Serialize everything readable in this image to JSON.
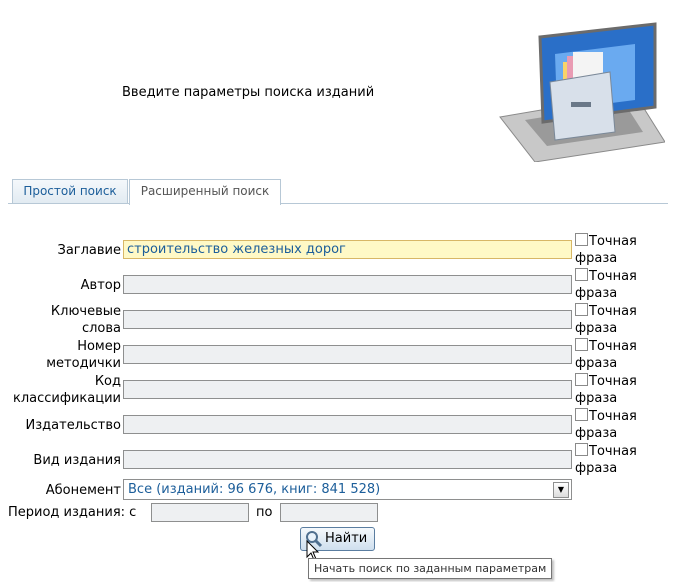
{
  "header": {
    "title": "Введите параметры поиска изданий"
  },
  "tabs": [
    {
      "label": "Простой поиск",
      "active": false
    },
    {
      "label": "Расширенный поиск",
      "active": true
    }
  ],
  "form": {
    "exact_label_1": "Точная",
    "exact_label_2": "фраза",
    "fields": [
      {
        "label": "Заглавие",
        "value": "строительство железных дорог"
      },
      {
        "label": "Автор",
        "value": ""
      },
      {
        "label_1": "Ключевые",
        "label_2": "слова",
        "value": ""
      },
      {
        "label_1": "Номер",
        "label_2": "методички",
        "value": ""
      },
      {
        "label_1": "Код",
        "label_2": "классификации",
        "value": ""
      },
      {
        "label": "Издательство",
        "value": ""
      },
      {
        "label": "Вид издания",
        "value": ""
      }
    ],
    "subscription": {
      "label": "Абонемент",
      "selected": "Все (изданий: 96 676, книг: 841 528)"
    },
    "period": {
      "label": "Период издания: с",
      "to_label": "по",
      "from_value": "",
      "to_value": ""
    }
  },
  "search_button": {
    "label": "Найти",
    "tooltip": "Начать поиск по заданным параметрам"
  },
  "colors": {
    "accent": "#1c5e9a",
    "highlight": "#fff9c6"
  }
}
